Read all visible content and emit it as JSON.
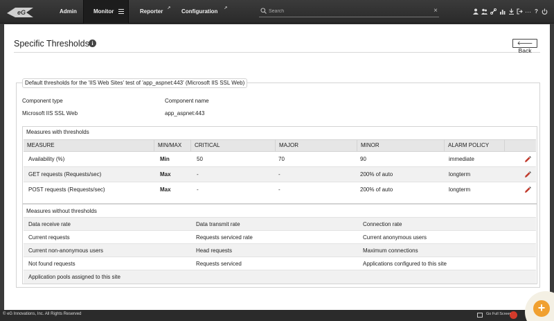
{
  "nav": {
    "admin": "Admin",
    "monitor": "Monitor",
    "reporter": "Reporter",
    "configuration": "Configuration"
  },
  "search": {
    "placeholder": "Search"
  },
  "page": {
    "title": "Specific Thresholds",
    "back_label": "Back"
  },
  "panel": {
    "legend": "Default thresholds for the 'IIS Web Sites' test of 'app_aspnet:443' (Microsoft IIS SSL Web)",
    "component_type_label": "Component type",
    "component_name_label": "Component name",
    "component_type_value": "Microsoft IIS SSL Web",
    "component_name_value": "app_aspnet:443"
  },
  "thresholds": {
    "title": "Measures with thresholds",
    "headers": [
      "MEASURE",
      "MIN/MAX",
      "CRITICAL",
      "MAJOR",
      "MINOR",
      "ALARM POLICY"
    ],
    "rows": [
      [
        "Availability (%)",
        "Min",
        "50",
        "70",
        "90",
        "immediate"
      ],
      [
        "GET requests (Requests/sec)",
        "Max",
        "-",
        "-",
        "200% of auto",
        "longterm"
      ],
      [
        "POST requests (Requests/sec)",
        "Max",
        "-",
        "-",
        "200% of auto",
        "longterm"
      ]
    ]
  },
  "no_thresholds": {
    "title": "Measures without thresholds",
    "rows": [
      [
        "Data receive rate",
        "Data transmit rate",
        "Connection rate"
      ],
      [
        "Current requests",
        "Requests serviced rate",
        "Current anonymous users"
      ],
      [
        "Current non-anonymous users",
        "Head requests",
        "Maximum connections"
      ],
      [
        "Not found requests",
        "Requests serviced",
        "Applications configured to this site"
      ],
      [
        "Application pools assigned to this site",
        "",
        ""
      ]
    ]
  },
  "footer": {
    "copyright": "© eG Innovations, Inc. All Rights Reserved",
    "fullscreen": "Go Full Screen"
  },
  "colors": {
    "topbar": "#2f2f2f",
    "accent_orange": "#f0a030",
    "edit_red": "#c0392b"
  },
  "icons": [
    "info-icon",
    "search-icon",
    "clear-icon",
    "edit-icon",
    "zoom-plus-icon",
    "fullscreen-icon"
  ]
}
